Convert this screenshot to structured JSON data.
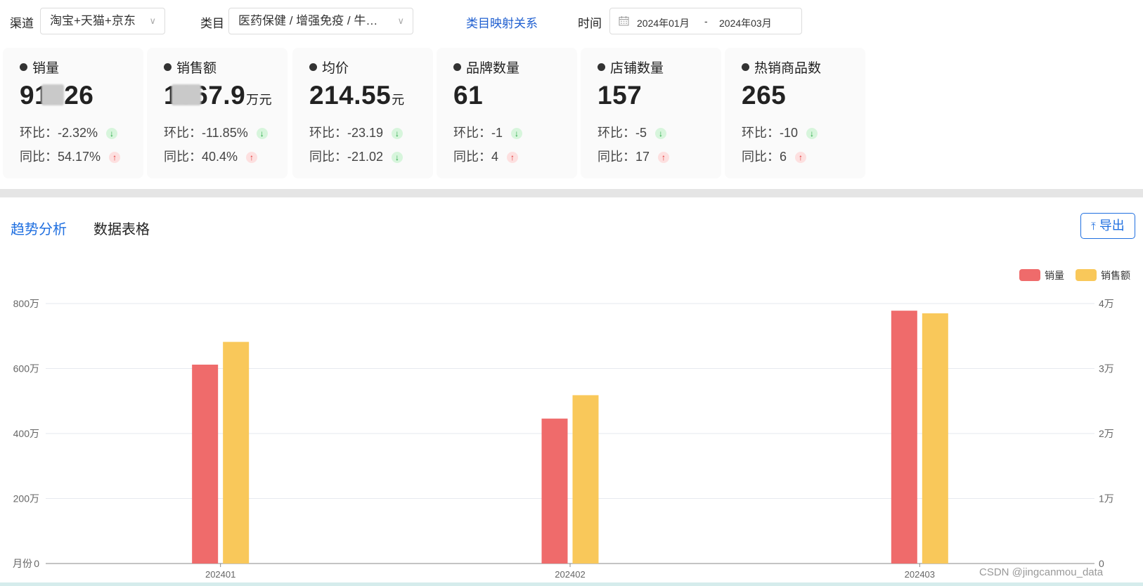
{
  "filters": {
    "channel_label": "渠道",
    "channel_value": "淘宝+天猫+京东",
    "category_label": "类目",
    "category_value": "医药保健 / 增强免疫 / 牛…",
    "mapping_link": "类目映射关系",
    "time_label": "时间",
    "date_start": "2024年01月",
    "date_sep": "-",
    "date_end": "2024年03月",
    "chevron_icon": "chevron-down-icon",
    "calendar_icon": "calendar-icon"
  },
  "kpis": [
    {
      "title": "销量",
      "value": "91726",
      "unit": "",
      "mom": "环比：-2.32%",
      "mom_dir": "down",
      "yoy": "同比：54.17%",
      "yoy_dir": "up"
    },
    {
      "title": "销售额",
      "value": "1667.9",
      "unit": "万元",
      "mom": "环比：-11.85%",
      "mom_dir": "down",
      "yoy": "同比：40.4%",
      "yoy_dir": "up"
    },
    {
      "title": "均价",
      "value": "214.55",
      "unit": "元",
      "mom": "环比：-23.19",
      "mom_dir": "down",
      "yoy": "同比：-21.02",
      "yoy_dir": "down"
    },
    {
      "title": "品牌数量",
      "value": "61",
      "unit": "",
      "mom": "环比：-1",
      "mom_dir": "down",
      "yoy": "同比：4",
      "yoy_dir": "up"
    },
    {
      "title": "店铺数量",
      "value": "157",
      "unit": "",
      "mom": "环比：-5",
      "mom_dir": "down",
      "yoy": "同比：17",
      "yoy_dir": "up"
    },
    {
      "title": "热销商品数",
      "value": "265",
      "unit": "",
      "mom": "环比：-10",
      "mom_dir": "down",
      "yoy": "同比：6",
      "yoy_dir": "up"
    }
  ],
  "tabs": {
    "trend": "趋势分析",
    "table": "数据表格"
  },
  "export_label": "导出",
  "colors": {
    "accent": "#1f6fe0",
    "sales_volume": "#ef6b6b",
    "sales_amount": "#f9c85a",
    "grid": "#e6e9ef"
  },
  "chart_data": {
    "type": "bar",
    "categories": [
      "202401",
      "202402",
      "202403"
    ],
    "series": [
      {
        "name": "销量",
        "axis": "right",
        "values": [
          30600,
          22300,
          38900
        ]
      },
      {
        "name": "销售额",
        "axis": "left",
        "values": [
          6820000,
          5180000,
          7700000
        ]
      }
    ],
    "left_axis": {
      "ticks": [
        "0",
        "200万",
        "400万",
        "600万",
        "800万"
      ],
      "max": 8000000
    },
    "right_axis": {
      "ticks": [
        "0",
        "1万",
        "2万",
        "3万",
        "4万"
      ],
      "max": 40000
    },
    "xlabel": "月份",
    "legend_position": "top-right",
    "grid": true
  },
  "watermark": "CSDN @jingcanmou_data"
}
